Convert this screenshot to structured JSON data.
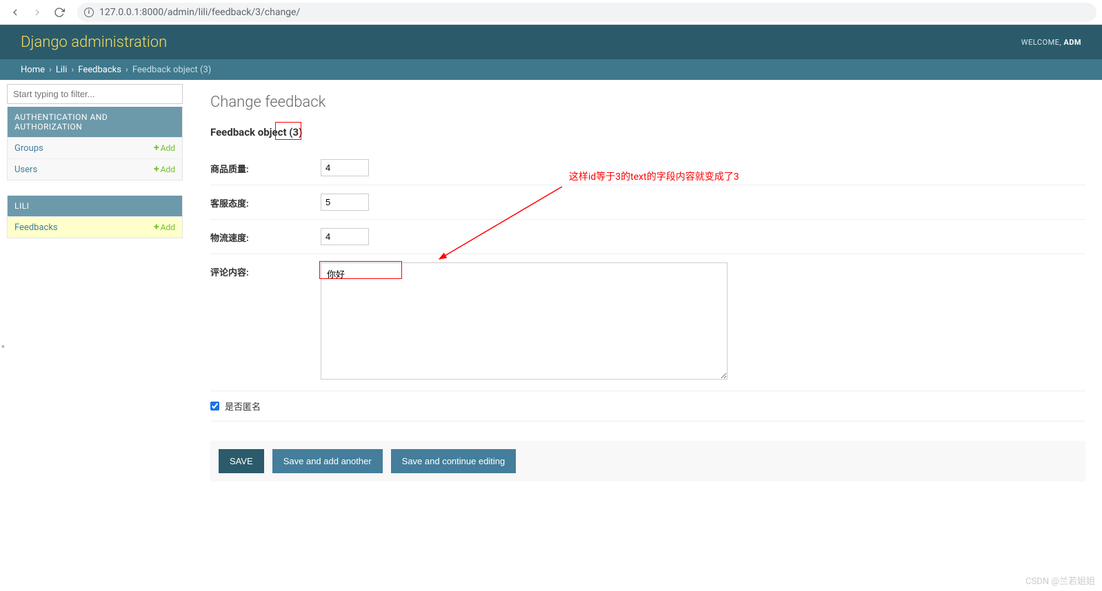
{
  "browser": {
    "url": "127.0.0.1:8000/admin/lili/feedback/3/change/"
  },
  "header": {
    "brand": "Django administration",
    "welcome": "WELCOME, ",
    "user": "ADM"
  },
  "breadcrumbs": {
    "home": "Home",
    "app": "Lili",
    "model": "Feedbacks",
    "object": "Feedback object (3)"
  },
  "sidebar": {
    "filter_placeholder": "Start typing to filter...",
    "add_label": "Add",
    "apps": [
      {
        "caption": "AUTHENTICATION AND AUTHORIZATION",
        "models": [
          {
            "name": "Groups"
          },
          {
            "name": "Users"
          }
        ]
      },
      {
        "caption": "LILI",
        "models": [
          {
            "name": "Feedbacks",
            "current": true
          }
        ]
      }
    ]
  },
  "content": {
    "page_title": "Change feedback",
    "object_title": "Feedback object (3)",
    "fields": {
      "quality_label": "商品质量:",
      "quality_value": "4",
      "service_label": "客服态度:",
      "service_value": "5",
      "speed_label": "物流速度:",
      "speed_value": "4",
      "text_label": "评论内容:",
      "text_value": "你好",
      "anon_label": "是否匿名"
    },
    "annotation": "这样id等于3的text的字段内容就变成了3",
    "buttons": {
      "save": "SAVE",
      "save_add": "Save and add another",
      "save_continue": "Save and continue editing"
    }
  },
  "watermark": "CSDN @兰若姐姐"
}
